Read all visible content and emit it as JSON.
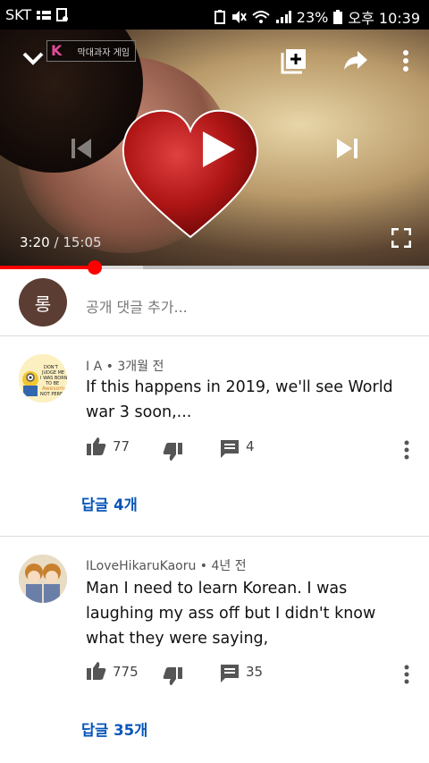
{
  "status_bar": {
    "carrier": "SKT",
    "battery": "23%",
    "time": "오후 10:39"
  },
  "player": {
    "channel_logo_text": "막대과자 게임",
    "elapsed": "3:20",
    "separator": "/",
    "duration": "15:05",
    "progress": 0.221,
    "buffered": 0.333
  },
  "add_comment": {
    "avatar_initial": "롱",
    "placeholder": "공개 댓글 추가..."
  },
  "comments": [
    {
      "author": "I A",
      "age": "3개월 전",
      "text": "If this happens in 2019, we'll see World war 3 soon,...",
      "likes": "77",
      "reply_count": "4",
      "replies_link": "답글 4개",
      "avatar_text": "DON'T JUDGE ME I WAS BORN TO BE Awesome NOT PERFECT"
    },
    {
      "author": "ILoveHikaruKaoru",
      "age": "4년 전",
      "text": "Man I need to learn Korean. I was laughing my ass off but I didn't know what they were saying,",
      "likes": "775",
      "reply_count": "35",
      "replies_link": "답글 35개"
    }
  ]
}
